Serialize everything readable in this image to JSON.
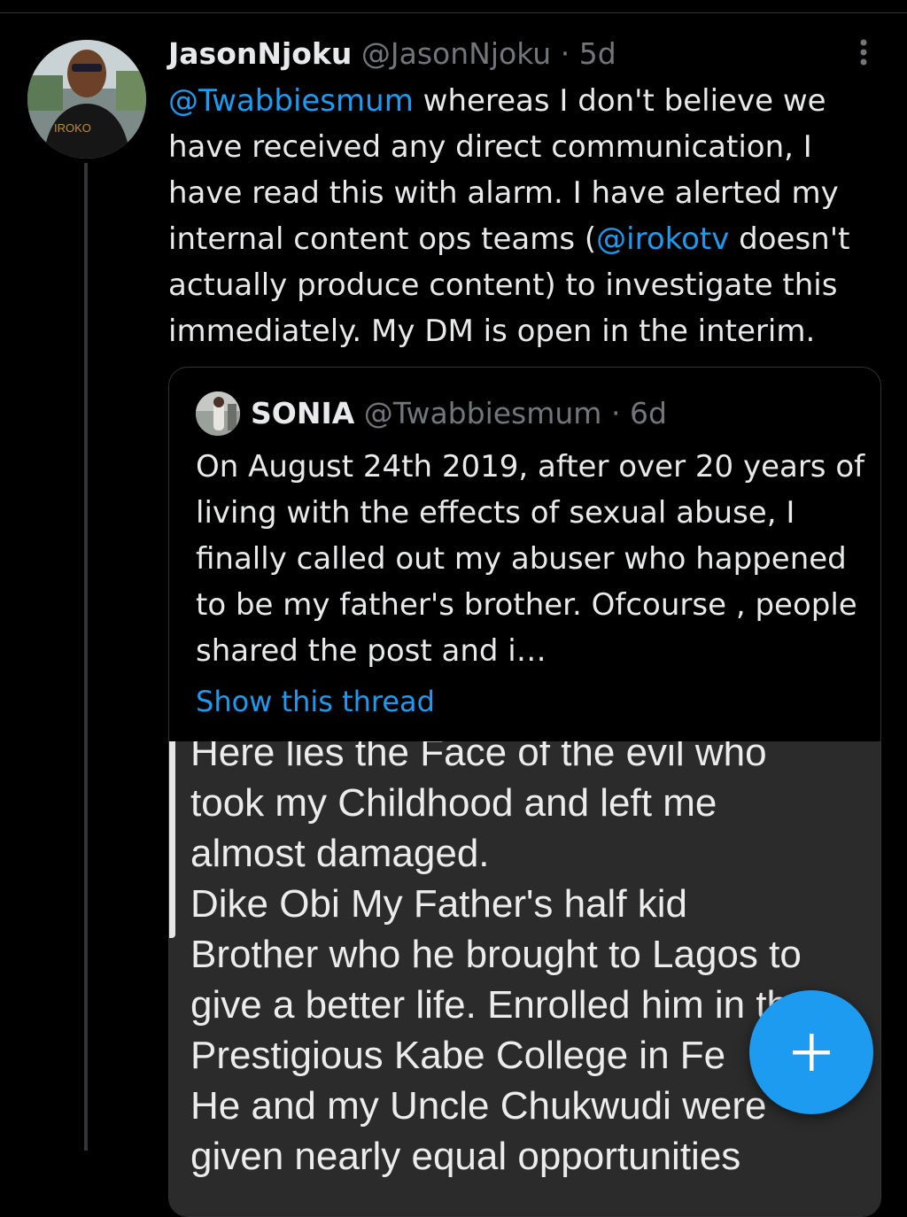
{
  "tweet": {
    "display_name": "JasonNjoku",
    "handle": "@JasonNjoku",
    "separator": "·",
    "time": "5d",
    "mention": "@Twabbiesmum",
    "text_part1": " whereas I don't believe we\nhave received any direct communication, I\nhave read this with alarm. I have alerted my\ninternal content ops teams (",
    "mention2": "@irokotv",
    "text_part2": " doesn't\nactually produce content) to investigate this\nimmediately. My DM is open in the interim.",
    "avatar_shirt_text": "IROKO"
  },
  "quoted": {
    "display_name": "SONIA",
    "handle": "@Twabbiesmum",
    "separator": "·",
    "time": "6d",
    "text": "On August 24th 2019, after over 20 years of living with the effects of sexual abuse, I finally called out my abuser who happened to be my father's brother. Ofcourse , people shared the post and i…",
    "show_thread": "Show this thread",
    "image_text": "Here lies the Face of the evil who\ntook my Childhood and left me\nalmost damaged.\n Dike Obi My Father's half  kid\nBrother who he brought to Lagos to\ngive a better life. Enrolled him in the\nPrestigious Kabe College in Fe\nHe and my Uncle Chukwudi were\ngiven nearly equal opportunities"
  },
  "colors": {
    "accent": "#1d9bf0",
    "background": "#000000",
    "text": "#e7e9ea",
    "muted": "#71767b"
  },
  "icons": {
    "more": "more-vertical-icon",
    "compose": "plus-icon"
  }
}
